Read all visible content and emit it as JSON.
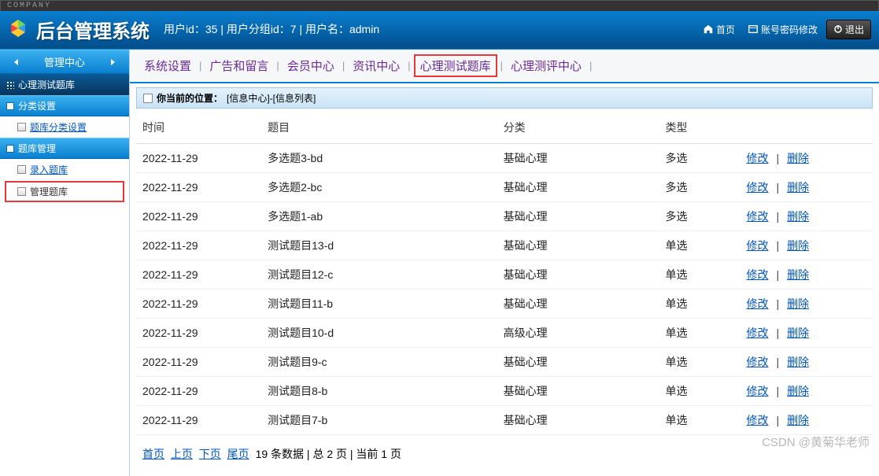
{
  "companyLabel": "COMPANY",
  "header": {
    "title": "后台管理系统",
    "userInfo": "用户id：35 | 用户分组id：7 | 用户名：admin",
    "homeLabel": "首页",
    "pwdLabel": "账号密码修改",
    "logoutLabel": "退出"
  },
  "sidebar": {
    "headerLabel": "管理中心",
    "subLabel": "心理测试题库",
    "panel1": "分类设置",
    "item1": "题库分类设置",
    "panel2": "题库管理",
    "item2a": "录入题库",
    "item2b": "管理题库"
  },
  "topnav": {
    "items": [
      "系统设置",
      "广告和留言",
      "会员中心",
      "资讯中心",
      "心理测试题库",
      "心理测评中心"
    ],
    "activeIndex": 4
  },
  "breadcrumb": {
    "prefix": "你当前的位置：",
    "path": "[信息中心]-[信息列表]"
  },
  "table": {
    "headers": [
      "时间",
      "题目",
      "分类",
      "类型",
      ""
    ],
    "editLabel": "修改",
    "deleteLabel": "删除",
    "rows": [
      {
        "time": "2022-11-29",
        "title": "多选题3-bd",
        "cat": "基础心理",
        "type": "多选"
      },
      {
        "time": "2022-11-29",
        "title": "多选题2-bc",
        "cat": "基础心理",
        "type": "多选"
      },
      {
        "time": "2022-11-29",
        "title": "多选题1-ab",
        "cat": "基础心理",
        "type": "多选"
      },
      {
        "time": "2022-11-29",
        "title": "测试题目13-d",
        "cat": "基础心理",
        "type": "单选"
      },
      {
        "time": "2022-11-29",
        "title": "测试题目12-c",
        "cat": "基础心理",
        "type": "单选"
      },
      {
        "time": "2022-11-29",
        "title": "测试题目11-b",
        "cat": "基础心理",
        "type": "单选"
      },
      {
        "time": "2022-11-29",
        "title": "测试题目10-d",
        "cat": "高级心理",
        "type": "单选"
      },
      {
        "time": "2022-11-29",
        "title": "测试题目9-c",
        "cat": "基础心理",
        "type": "单选"
      },
      {
        "time": "2022-11-29",
        "title": "测试题目8-b",
        "cat": "基础心理",
        "type": "单选"
      },
      {
        "time": "2022-11-29",
        "title": "测试题目7-b",
        "cat": "基础心理",
        "type": "单选"
      }
    ]
  },
  "pagination": {
    "first": "首页",
    "prev": "上页",
    "next": "下页",
    "last": "尾页",
    "info": "19 条数据 | 总 2 页 | 当前 1 页"
  },
  "watermark": "CSDN @黄菊华老师"
}
